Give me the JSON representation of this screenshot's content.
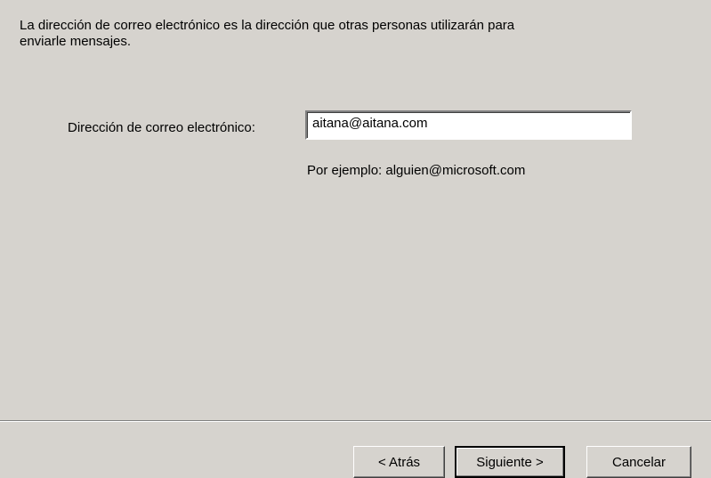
{
  "intro": {
    "line1": "La dirección de correo electrónico es la dirección que otras personas utilizarán para",
    "line2": "enviarle mensajes."
  },
  "email": {
    "label": "Dirección de correo electrónico:",
    "value": "aitana@aitana.com",
    "example": "Por ejemplo: alguien@microsoft.com"
  },
  "buttons": {
    "back": "< Atrás",
    "next": "Siguiente >",
    "cancel": "Cancelar"
  }
}
